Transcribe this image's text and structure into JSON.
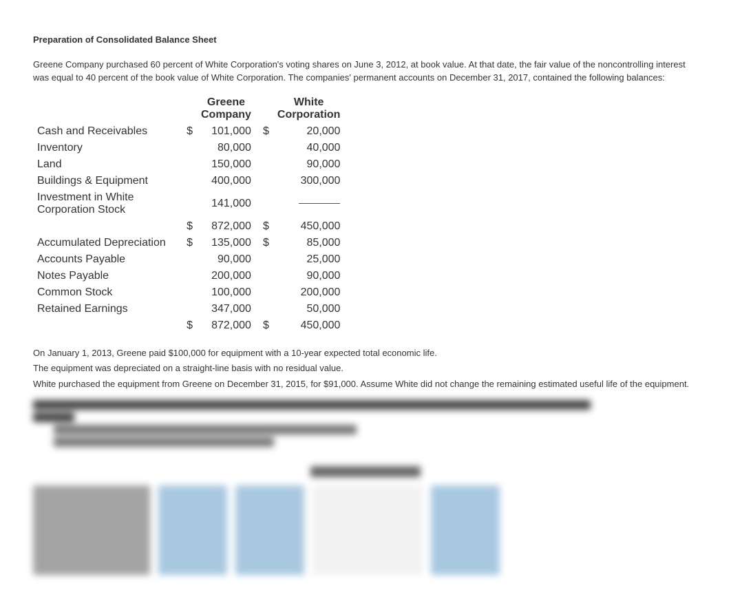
{
  "heading": "Preparation of Consolidated Balance Sheet",
  "intro": "Greene Company purchased 60 percent of White Corporation's voting shares on June 3, 2012, at book value. At that date, the fair value of the noncontrolling interest was equal to 40 percent of the book value of White Corporation. The companies' permanent accounts on December 31, 2017, contained the following balances:",
  "col_headers": {
    "greene_line1": "Greene",
    "greene_line2": "Company",
    "white_line1": "White",
    "white_line2": "Corporation"
  },
  "rows_top": [
    {
      "label": "Cash and Receivables",
      "gcur": "$",
      "gval": "101,000",
      "wcur": "$",
      "wval": "20,000"
    },
    {
      "label": "Inventory",
      "gcur": "",
      "gval": "80,000",
      "wcur": "",
      "wval": "40,000"
    },
    {
      "label": "Land",
      "gcur": "",
      "gval": "150,000",
      "wcur": "",
      "wval": "90,000"
    },
    {
      "label": "Buildings & Equipment",
      "gcur": "",
      "gval": "400,000",
      "wcur": "",
      "wval": "300,000"
    }
  ],
  "investment_row": {
    "label": "Investment in White Corporation Stock",
    "gval": "141,000"
  },
  "subtotal_row": {
    "gcur": "$",
    "gval": "872,000",
    "wcur": "$",
    "wval": "450,000"
  },
  "rows_bottom": [
    {
      "label": "Accumulated Depreciation",
      "gcur": "$",
      "gval": "135,000",
      "wcur": "$",
      "wval": "85,000"
    },
    {
      "label": "Accounts Payable",
      "gcur": "",
      "gval": "90,000",
      "wcur": "",
      "wval": "25,000"
    },
    {
      "label": "Notes Payable",
      "gcur": "",
      "gval": "200,000",
      "wcur": "",
      "wval": "90,000"
    },
    {
      "label": "Common Stock",
      "gcur": "",
      "gval": "100,000",
      "wcur": "",
      "wval": "200,000"
    },
    {
      "label": "Retained Earnings",
      "gcur": "",
      "gval": "347,000",
      "wcur": "",
      "wval": "50,000"
    }
  ],
  "total_row": {
    "gcur": "$",
    "gval": "872,000",
    "wcur": "$",
    "wval": "450,000"
  },
  "notes": [
    "On January 1, 2013, Greene paid $100,000 for equipment with a 10-year expected total economic life.",
    " The equipment was depreciated on a straight-line basis with no residual value.",
    "White purchased the equipment from Greene on December 31, 2015, for $91,000. Assume White did not change the remaining estimated useful life of the equipment."
  ]
}
